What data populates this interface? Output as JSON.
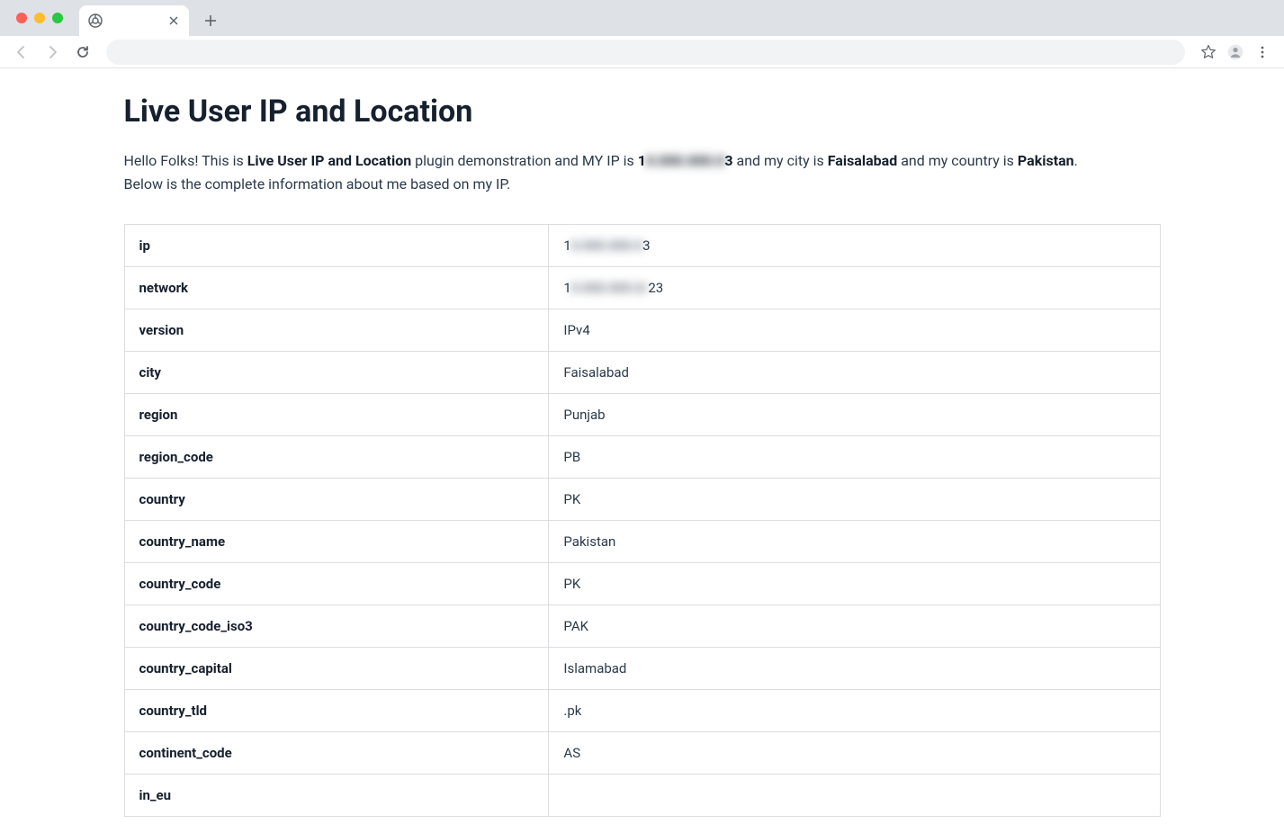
{
  "browser": {
    "tab_title": "",
    "address": ""
  },
  "page": {
    "heading": "Live User IP and Location",
    "intro": {
      "hello": "Hello Folks! This is ",
      "plugin_name": "Live User IP and Location",
      "after_plugin": " plugin demonstration and MY IP is ",
      "ip_prefix": "1",
      "ip_blur": "0.000.000.0",
      "ip_suffix": "3",
      "after_ip": " and my city is ",
      "city": "Faisalabad",
      "after_city": " and my country is ",
      "country": "Pakistan",
      "period": ".",
      "line2": "Below is the complete information about me based on my IP."
    },
    "rows": [
      {
        "key": "ip",
        "prefix": "1",
        "blur": "0.000.000.0",
        "suffix": "3"
      },
      {
        "key": "network",
        "prefix": "1",
        "blur": "0.000.000.0/",
        "suffix": "23"
      },
      {
        "key": "version",
        "value": "IPv4"
      },
      {
        "key": "city",
        "value": "Faisalabad"
      },
      {
        "key": "region",
        "value": "Punjab"
      },
      {
        "key": "region_code",
        "value": "PB"
      },
      {
        "key": "country",
        "value": "PK"
      },
      {
        "key": "country_name",
        "value": "Pakistan"
      },
      {
        "key": "country_code",
        "value": "PK"
      },
      {
        "key": "country_code_iso3",
        "value": "PAK"
      },
      {
        "key": "country_capital",
        "value": "Islamabad"
      },
      {
        "key": "country_tld",
        "value": ".pk"
      },
      {
        "key": "continent_code",
        "value": "AS"
      },
      {
        "key": "in_eu",
        "value": ""
      }
    ]
  }
}
